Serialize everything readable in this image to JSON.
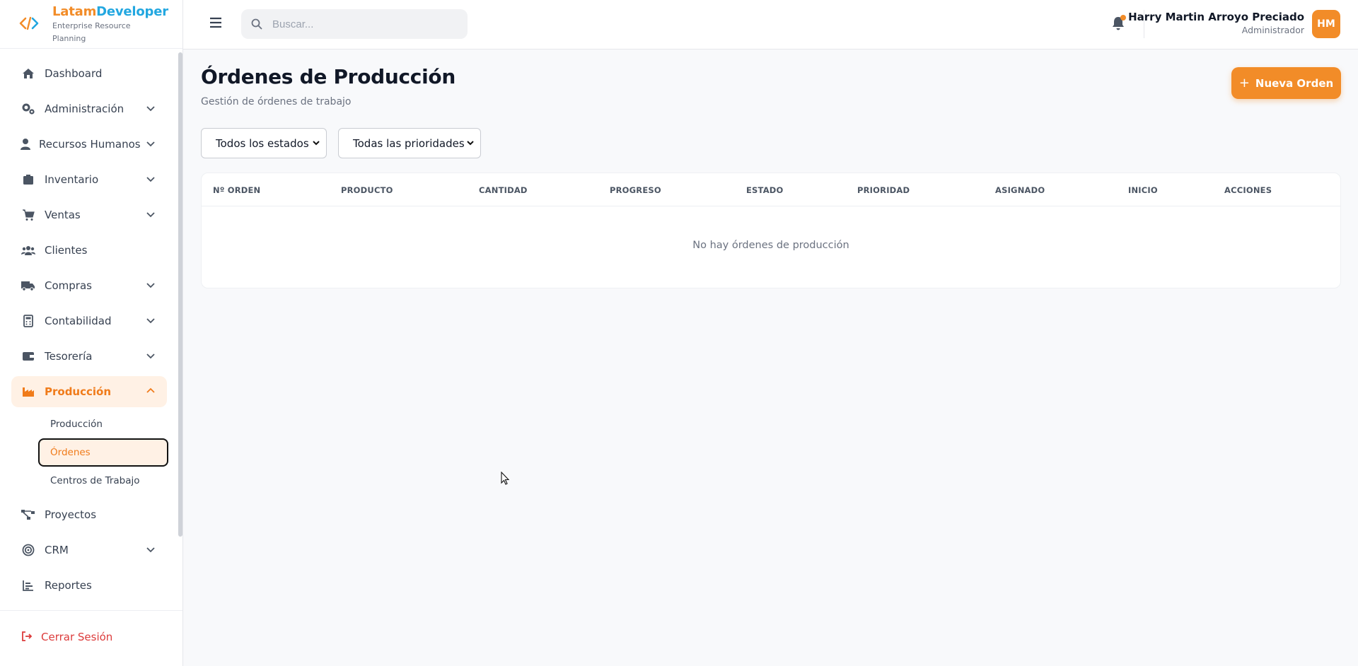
{
  "brand": {
    "name_part1": "Latam",
    "name_part2": "Developer",
    "subtitle": "Enterprise Resource Planning",
    "colors": {
      "orange": "#f28c28",
      "blue": "#22a7e0"
    }
  },
  "sidebar": {
    "items": [
      {
        "label": "Dashboard",
        "icon": "home-icon",
        "has_chevron": false
      },
      {
        "label": "Administración",
        "icon": "gears-icon",
        "has_chevron": true
      },
      {
        "label": "Recursos Humanos",
        "icon": "user-icon",
        "has_chevron": true
      },
      {
        "label": "Inventario",
        "icon": "box-icon",
        "has_chevron": true
      },
      {
        "label": "Ventas",
        "icon": "cart-icon",
        "has_chevron": true
      },
      {
        "label": "Clientes",
        "icon": "users-icon",
        "has_chevron": false
      },
      {
        "label": "Compras",
        "icon": "truck-icon",
        "has_chevron": true
      },
      {
        "label": "Contabilidad",
        "icon": "calculator-icon",
        "has_chevron": true
      },
      {
        "label": "Tesorería",
        "icon": "wallet-icon",
        "has_chevron": true
      },
      {
        "label": "Producción",
        "icon": "industry-icon",
        "has_chevron": true,
        "active": true,
        "expanded": true
      },
      {
        "label": "Proyectos",
        "icon": "project-diagram-icon",
        "has_chevron": false
      },
      {
        "label": "CRM",
        "icon": "target-icon",
        "has_chevron": true
      },
      {
        "label": "Reportes",
        "icon": "chart-icon",
        "has_chevron": false
      }
    ],
    "produccion_sub": [
      {
        "label": "Producción"
      },
      {
        "label": "Órdenes",
        "active": true
      },
      {
        "label": "Centros de Trabajo"
      }
    ],
    "logout_label": "Cerrar Sesión"
  },
  "topbar": {
    "search_placeholder": "Buscar...",
    "user_name": "Harry Martin Arroyo Preciado",
    "user_role": "Administrador",
    "avatar_initials": "HM"
  },
  "main": {
    "title": "Órdenes de Producción",
    "subtitle": "Gestión de órdenes de trabajo",
    "new_button": "Nueva Orden",
    "filters": {
      "estado": "Todos los estados",
      "prioridad": "Todas las prioridades"
    },
    "table": {
      "columns": [
        "Nº ORDEN",
        "PRODUCTO",
        "CANTIDAD",
        "PROGRESO",
        "ESTADO",
        "PRIORIDAD",
        "ASIGNADO",
        "INICIO",
        "ACCIONES"
      ],
      "empty_text": "No hay órdenes de producción"
    }
  },
  "colors": {
    "accent": "#f28c28",
    "active_bg": "#fff1e5",
    "logout": "#dc3b3b"
  }
}
